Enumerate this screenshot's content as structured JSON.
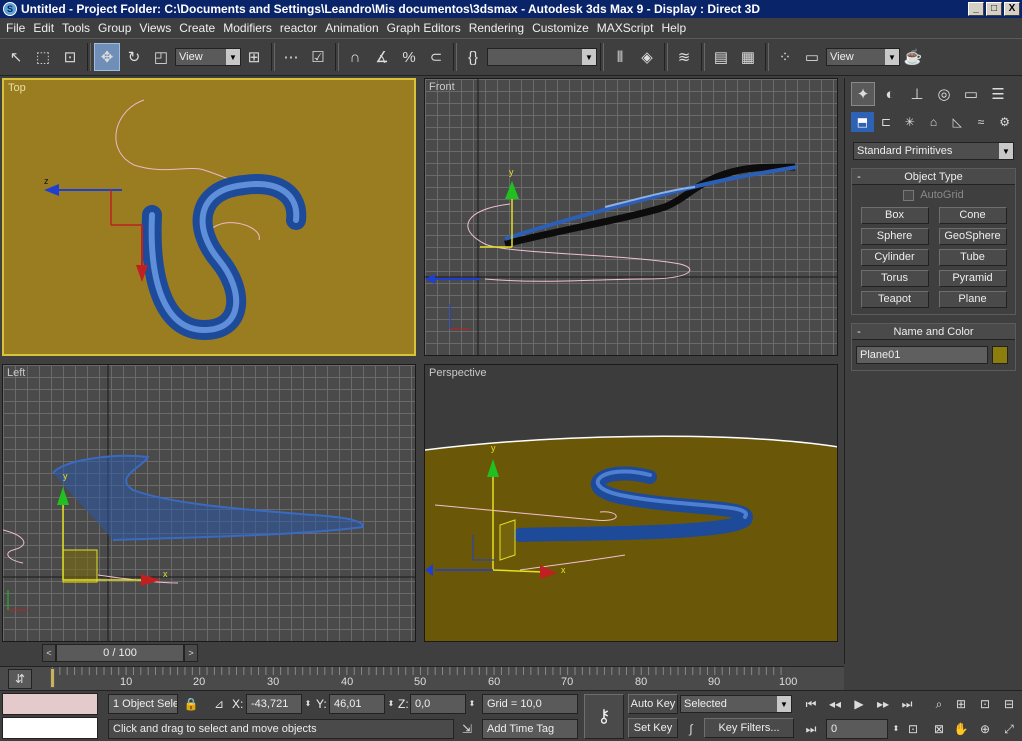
{
  "window": {
    "title": "Untitled    - Project Folder: C:\\Documents and Settings\\Leandro\\Mis documentos\\3dsmax    - Autodesk 3ds Max 9    - Display : Direct 3D",
    "min": "_",
    "max": "□",
    "close": "X"
  },
  "menu": [
    "File",
    "Edit",
    "Tools",
    "Group",
    "Views",
    "Create",
    "Modifiers",
    "reactor",
    "Animation",
    "Graph Editors",
    "Rendering",
    "Customize",
    "MAXScript",
    "Help"
  ],
  "toolbar": {
    "ref_coord": "View",
    "named_sel": "",
    "right_view": "View",
    "icons": [
      "select-icon",
      "region-icon",
      "window-icon",
      "move-icon",
      "rotate-icon",
      "scale-icon",
      "pivot-icon",
      "link-icon",
      "unlink-icon",
      "bind-icon",
      "snap-icon",
      "angle-snap-icon",
      "percent-snap-icon",
      "spinner-snap-icon",
      "named-set-icon",
      "mirror-icon",
      "align-icon",
      "layer-icon",
      "curve-icon",
      "schematic-icon",
      "material-icon",
      "render-scene-icon",
      "quick-render-icon"
    ]
  },
  "viewports": {
    "top": "Top",
    "front": "Front",
    "left": "Left",
    "perspective": "Perspective"
  },
  "command_panel": {
    "category": "Standard Primitives",
    "object_type_title": "Object Type",
    "autogrid": "AutoGrid",
    "primitives": [
      "Box",
      "Cone",
      "Sphere",
      "GeoSphere",
      "Cylinder",
      "Tube",
      "Torus",
      "Pyramid",
      "Teapot",
      "Plane"
    ],
    "name_color_title": "Name and Color",
    "object_name": "Plane01",
    "object_color": "#8c7d0c",
    "collapse": "-"
  },
  "timeline": {
    "frame": "0 / 100",
    "prev": "<",
    "next": ">",
    "ticks": [
      "10",
      "20",
      "30",
      "40",
      "50",
      "60",
      "70",
      "80",
      "90",
      "100"
    ]
  },
  "status": {
    "selection": "1 Object Sele",
    "x_label": "X:",
    "x": "-43,721",
    "y_label": "Y:",
    "y": "46,01",
    "z_label": "Z:",
    "z": "0,0",
    "grid": "Grid = 10,0",
    "prompt": "Click and drag to select and move objects",
    "add_time_tag": "Add Time Tag",
    "auto_key": "Auto Key",
    "set_key": "Set Key",
    "key_mode": "Selected",
    "key_filters": "Key Filters...",
    "current_frame": "0"
  }
}
